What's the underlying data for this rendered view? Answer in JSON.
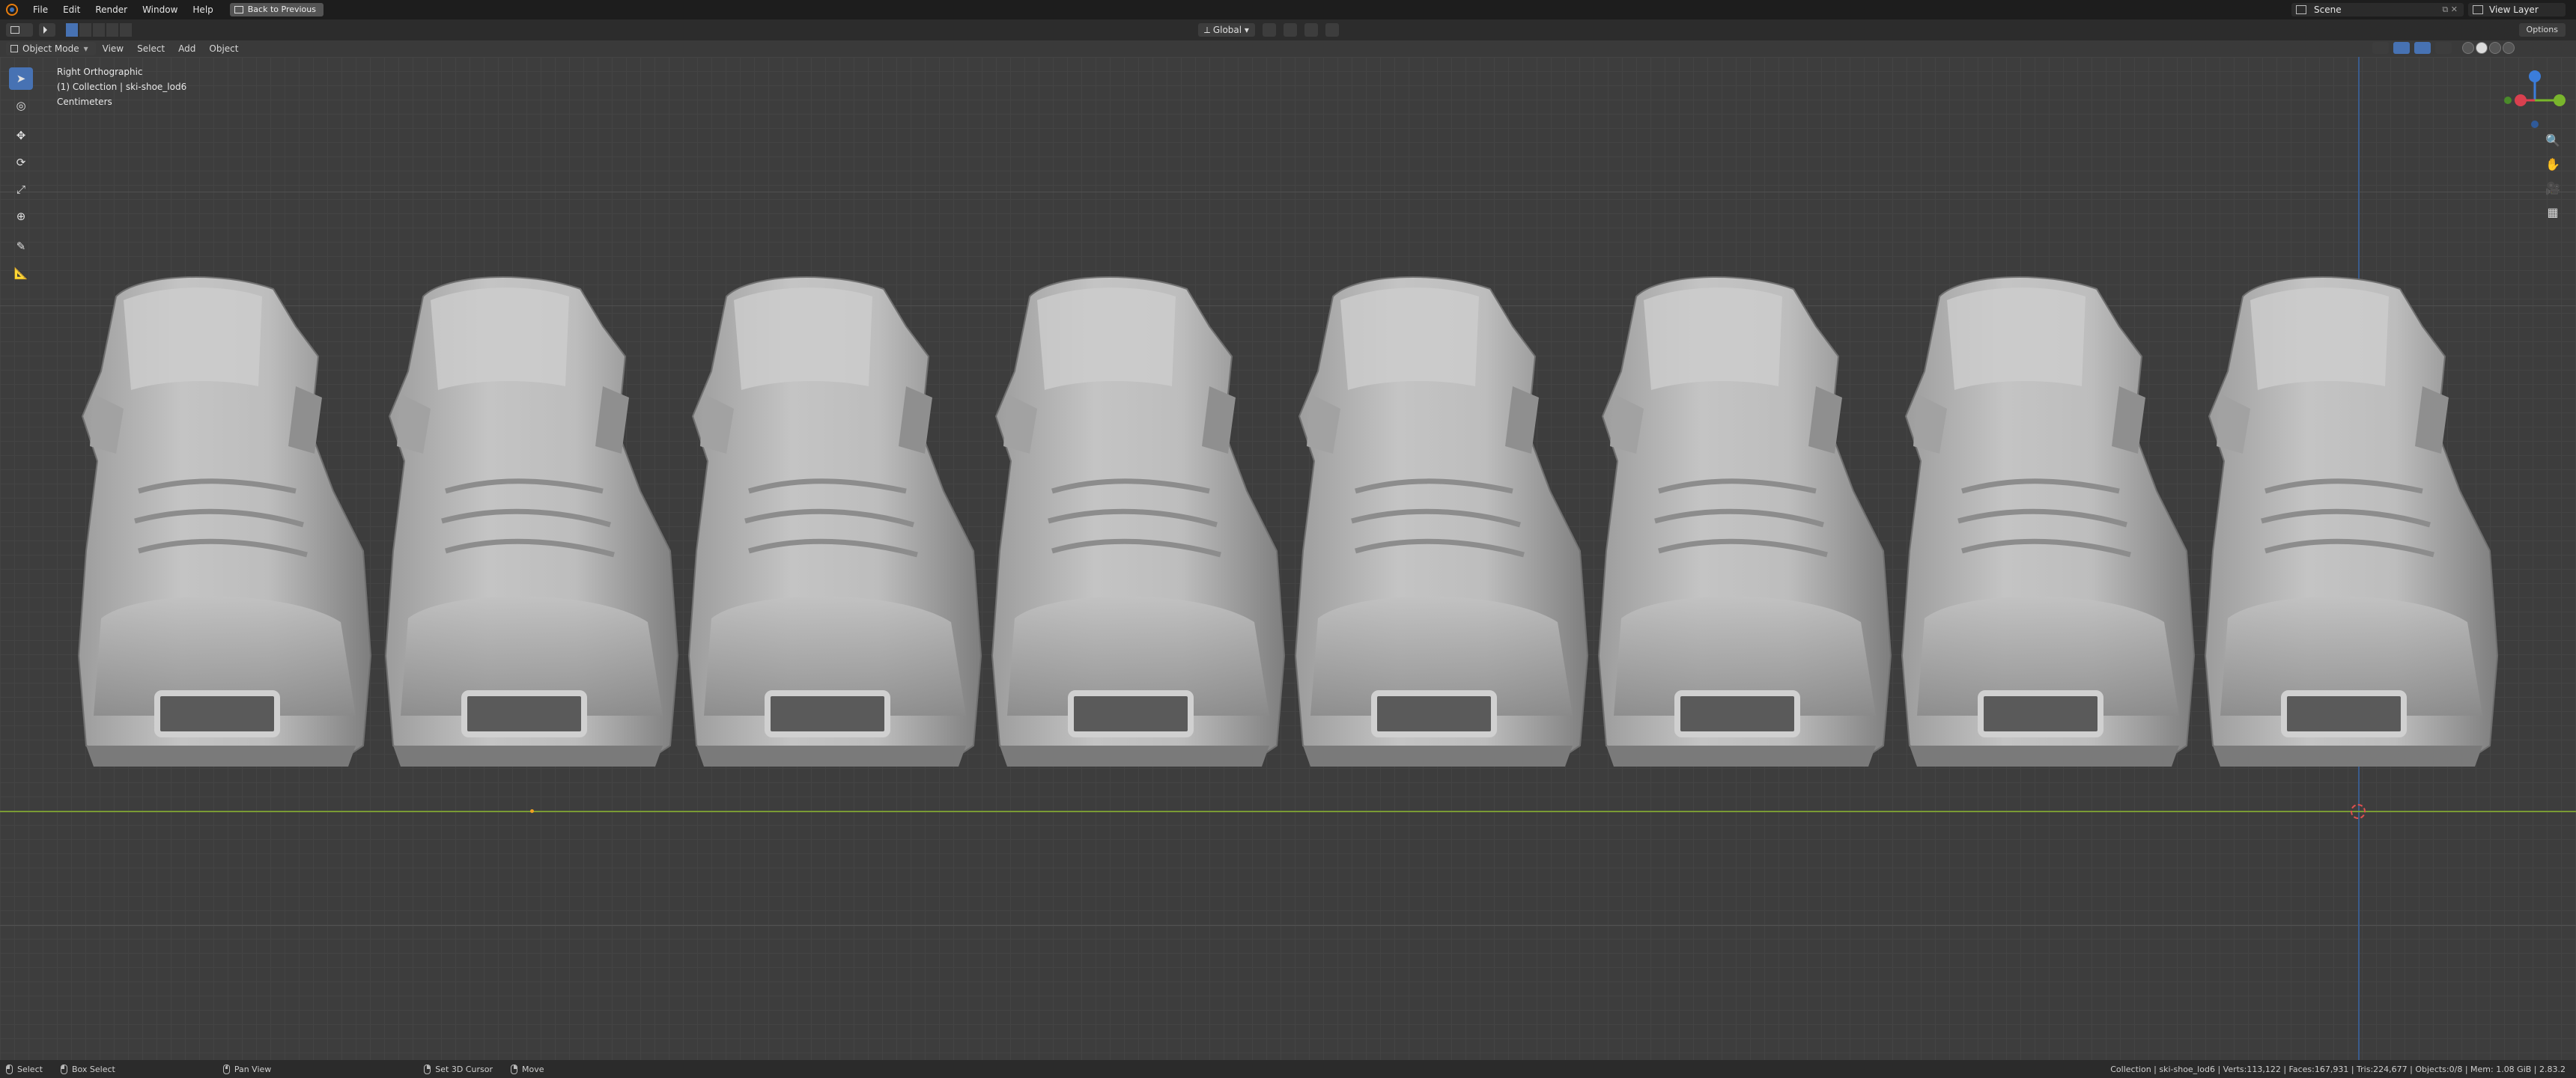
{
  "menu": {
    "items": [
      "File",
      "Edit",
      "Render",
      "Window",
      "Help"
    ],
    "back_button": "Back to Previous"
  },
  "scene": {
    "label": "Scene"
  },
  "view_layer": {
    "label": "View Layer"
  },
  "header": {
    "transform_orientation": "Global",
    "options_label": "Options",
    "mode": "Object Mode",
    "view_menu": [
      "View",
      "Select",
      "Add",
      "Object"
    ]
  },
  "viewport": {
    "view_name": "Right Orthographic",
    "collection_line": "(1) Collection | ski-shoe_lod6",
    "units": "Centimeters",
    "boot_count": 8,
    "colors": {
      "ground_axis": "#7a9a34",
      "z_axis": "#3a5b8c",
      "select_blue": "#4772b3",
      "boot_base": "#b8b8b8"
    }
  },
  "gizmo": {
    "axes": [
      {
        "name": "Z",
        "color": "#3b7ddb"
      },
      {
        "name": "X",
        "color": "#d9404f"
      },
      {
        "name": "Y",
        "color": "#79b52c"
      }
    ]
  },
  "status": {
    "left_actions": [
      {
        "label": "Select",
        "icon": "mouse-left-icon"
      },
      {
        "label": "Box Select",
        "icon": "mouse-left-icon"
      },
      {
        "label": "Pan View",
        "icon": "mouse-middle-icon"
      },
      {
        "label": "Set 3D Cursor",
        "icon": "mouse-right-icon"
      },
      {
        "label": "Move",
        "icon": "mouse-right-icon"
      }
    ],
    "stats": "Collection | ski-shoe_lod6 | Verts:113,122 | Faces:167,931 | Tris:224,677 | Objects:0/8 | Mem: 1.08 GiB | 2.83.2"
  }
}
